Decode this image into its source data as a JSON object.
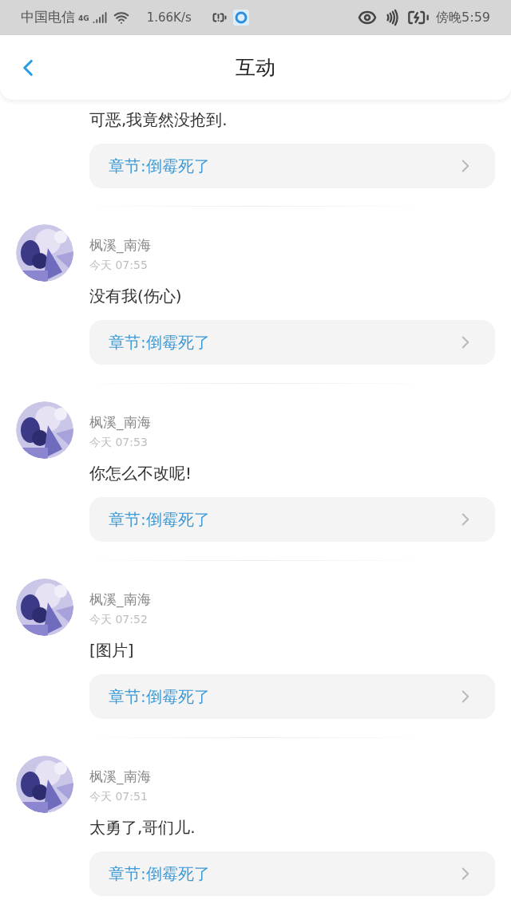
{
  "status_bar": {
    "carrier": "中国电信",
    "network": "4G",
    "speed": "1.66K/s",
    "time": "傍晚5:59"
  },
  "header": {
    "title": "互动"
  },
  "comments": [
    {
      "kind": "partial",
      "message": "可恶,我竟然没抢到.",
      "chapter": "章节:倒霉死了"
    },
    {
      "kind": "full",
      "author": "枫溪_南海",
      "time": "今天 07:55",
      "message": "没有我(伤心)",
      "chapter": "章节:倒霉死了"
    },
    {
      "kind": "full",
      "author": "枫溪_南海",
      "time": "今天 07:53",
      "message": "你怎么不改呢!",
      "chapter": "章节:倒霉死了"
    },
    {
      "kind": "full",
      "author": "枫溪_南海",
      "time": "今天 07:52",
      "message": "[图片]",
      "chapter": "章节:倒霉死了"
    },
    {
      "kind": "full",
      "author": "枫溪_南海",
      "time": "今天 07:51",
      "message": "太勇了,哥们儿.",
      "chapter": "章节:倒霉死了"
    }
  ]
}
